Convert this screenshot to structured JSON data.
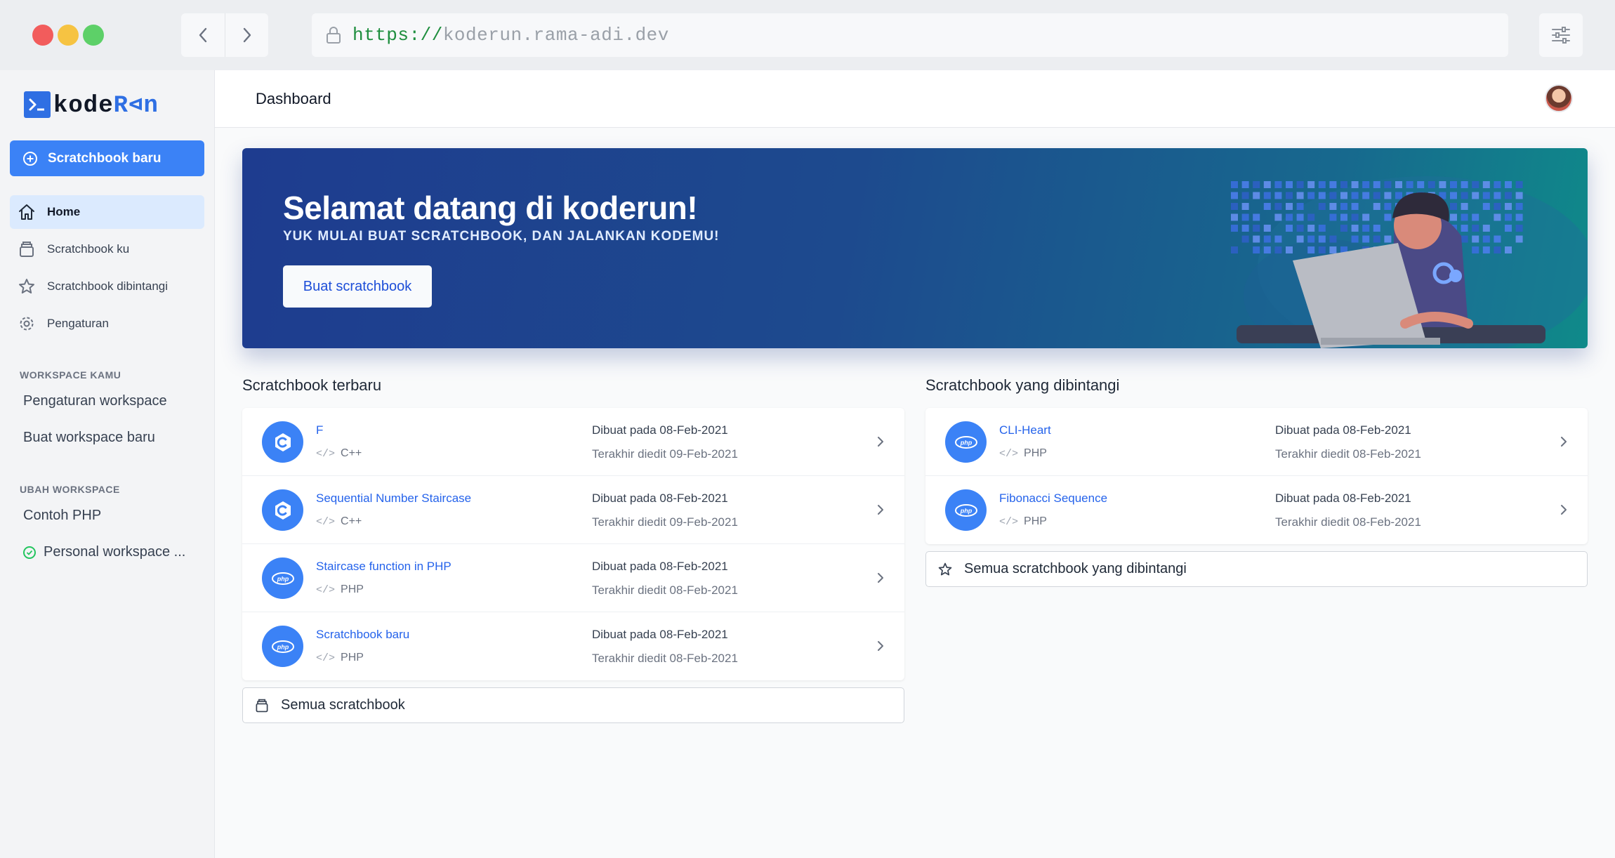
{
  "browser": {
    "url_scheme": "https://",
    "url_host": "koderun.rama-adi.dev"
  },
  "logo": {
    "part1": "kode",
    "part2": "R",
    "part3": "⊲",
    "part4": "n"
  },
  "sidebar": {
    "new_button": "Scratchbook baru",
    "nav": [
      {
        "label": "Home",
        "icon": "home-icon"
      },
      {
        "label": "Scratchbook ku",
        "icon": "archive-icon"
      },
      {
        "label": "Scratchbook dibintangi",
        "icon": "star-icon"
      },
      {
        "label": "Pengaturan",
        "icon": "gear-icon"
      }
    ],
    "workspace_section": "WORKSPACE KAMU",
    "workspace_links": [
      "Pengaturan workspace",
      "Buat workspace baru"
    ],
    "switch_section": "UBAH WORKSPACE",
    "workspaces": [
      "Contoh PHP",
      "Personal workspace ..."
    ]
  },
  "header": {
    "title": "Dashboard"
  },
  "hero": {
    "title": "Selamat datang di koderun!",
    "subtitle": "YUK MULAI BUAT SCRATCHBOOK, DAN JALANKAN KODEMU!",
    "cta": "Buat scratchbook"
  },
  "recent": {
    "title": "Scratchbook terbaru",
    "items": [
      {
        "name": "F",
        "lang": "C++",
        "created": "Dibuat pada 08-Feb-2021",
        "edited": "Terakhir diedit 09-Feb-2021",
        "icon": "cpp-icon"
      },
      {
        "name": "Sequential Number Staircase",
        "lang": "C++",
        "created": "Dibuat pada 08-Feb-2021",
        "edited": "Terakhir diedit 09-Feb-2021",
        "icon": "cpp-icon"
      },
      {
        "name": "Staircase function in PHP",
        "lang": "PHP",
        "created": "Dibuat pada 08-Feb-2021",
        "edited": "Terakhir diedit 08-Feb-2021",
        "icon": "php-icon"
      },
      {
        "name": "Scratchbook baru",
        "lang": "PHP",
        "created": "Dibuat pada 08-Feb-2021",
        "edited": "Terakhir diedit 08-Feb-2021",
        "icon": "php-icon"
      }
    ],
    "all_button": "Semua scratchbook"
  },
  "starred": {
    "title": "Scratchbook yang dibintangi",
    "items": [
      {
        "name": "CLI-Heart",
        "lang": "PHP",
        "created": "Dibuat pada 08-Feb-2021",
        "edited": "Terakhir diedit 08-Feb-2021",
        "icon": "php-icon"
      },
      {
        "name": "Fibonacci Sequence",
        "lang": "PHP",
        "created": "Dibuat pada 08-Feb-2021",
        "edited": "Terakhir diedit 08-Feb-2021",
        "icon": "php-icon"
      }
    ],
    "all_button": "Semua scratchbook yang dibintangi"
  },
  "code_glyph": "</>",
  "colors": {
    "accent": "#3b82f6",
    "link": "#2563eb",
    "hero_start": "#1e3c8f",
    "hero_end": "#0f8a8a"
  }
}
